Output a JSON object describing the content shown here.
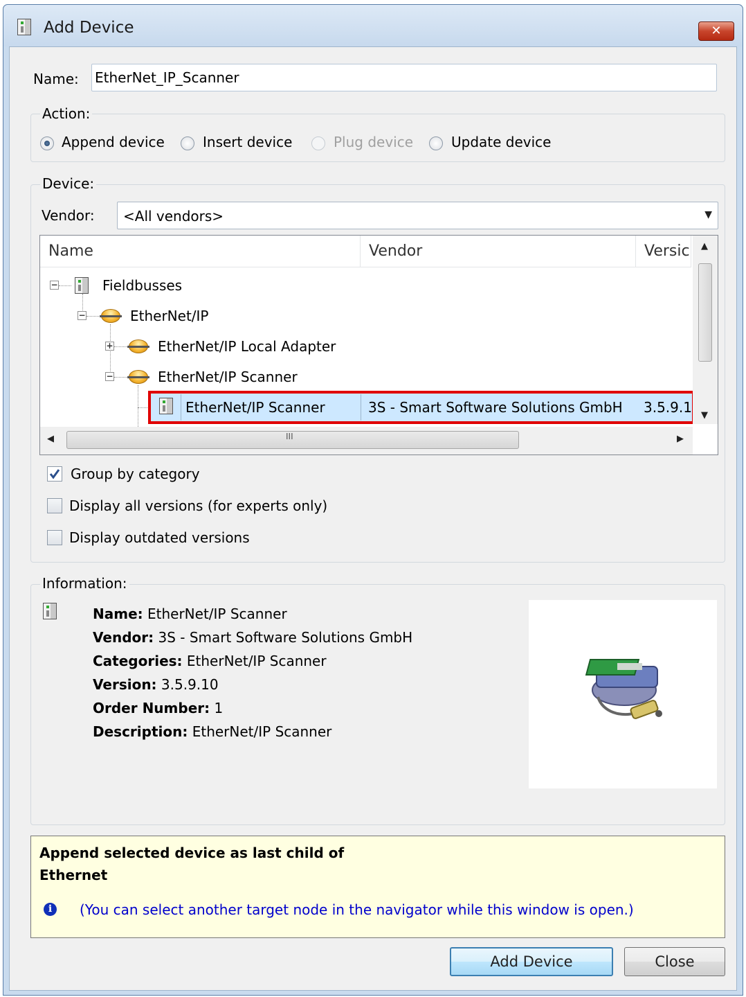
{
  "window": {
    "title": "Add Device",
    "close_glyph": "✕"
  },
  "name_field": {
    "label": "Name:",
    "value": "EtherNet_IP_Scanner"
  },
  "action": {
    "title": "Action:",
    "options": [
      {
        "label": "Append device",
        "checked": true,
        "enabled": true
      },
      {
        "label": "Insert device",
        "checked": false,
        "enabled": true
      },
      {
        "label": "Plug device",
        "checked": false,
        "enabled": false
      },
      {
        "label": "Update device",
        "checked": false,
        "enabled": true
      }
    ]
  },
  "device": {
    "title": "Device:",
    "vendor_label": "Vendor:",
    "vendor_value": "<All vendors>",
    "columns": [
      "Name",
      "Vendor",
      "Versic"
    ],
    "tree": [
      {
        "label": "Fieldbusses",
        "icon": "device-icon",
        "expander": "−"
      },
      {
        "label": "EtherNet/IP",
        "icon": "network-icon",
        "expander": "−"
      },
      {
        "label": "EtherNet/IP Local Adapter",
        "icon": "network-icon",
        "expander": "+"
      },
      {
        "label": "EtherNet/IP Scanner",
        "icon": "network-icon",
        "expander": "−"
      },
      {
        "label": "EtherNet/IP Scanner",
        "icon": "device-icon",
        "vendor": "3S - Smart Software Solutions GmbH",
        "version": "3.5.9.1",
        "selected": true
      }
    ],
    "hscroll_grip": "III"
  },
  "options": [
    {
      "label": "Group by category",
      "checked": true
    },
    {
      "label": "Display all versions (for experts only)",
      "checked": false
    },
    {
      "label": "Display outdated versions",
      "checked": false
    }
  ],
  "information": {
    "title": "Information:",
    "fields": [
      {
        "key": "Name:",
        "value": "EtherNet/IP Scanner"
      },
      {
        "key": "Vendor:",
        "value": "3S - Smart Software Solutions GmbH"
      },
      {
        "key": "Categories:",
        "value": "EtherNet/IP Scanner"
      },
      {
        "key": "Version:",
        "value": "3.5.9.10"
      },
      {
        "key": "Order Number:",
        "value": "1"
      },
      {
        "key": "Description:",
        "value": "EtherNet/IP Scanner"
      }
    ]
  },
  "note": {
    "line1": "Append selected device as last child of",
    "line2": "Ethernet",
    "hint": "(You can select another target node in the navigator while this window is open.)"
  },
  "buttons": {
    "add": "Add Device",
    "close": "Close"
  },
  "colors": {
    "selection": "#cde8ff",
    "highlight_border": "#e00000",
    "hint_text": "#0000cc",
    "note_bg": "#ffffe1"
  }
}
